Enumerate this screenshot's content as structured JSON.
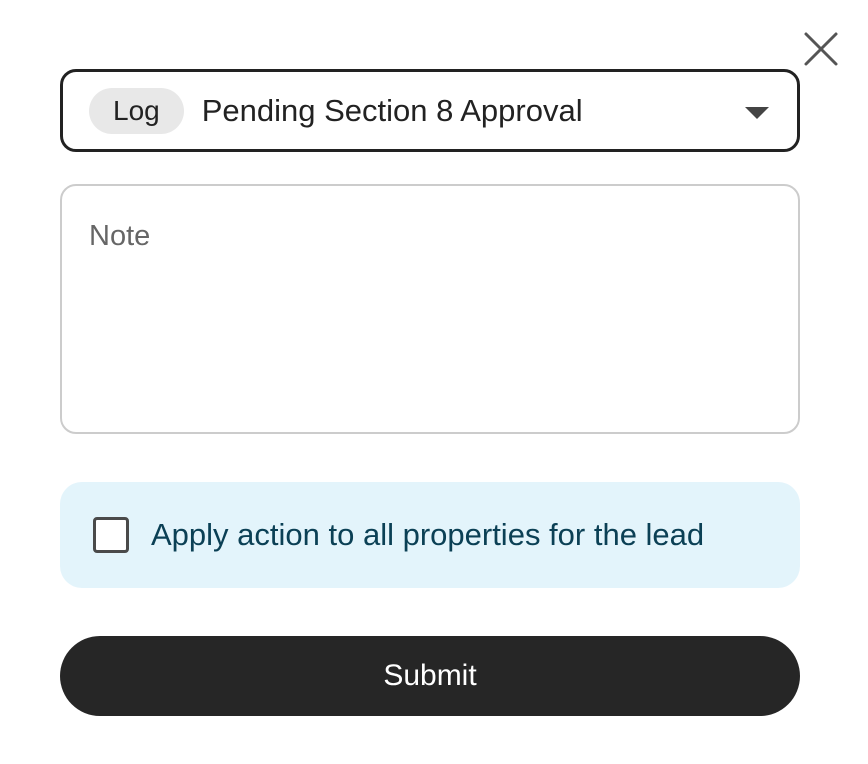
{
  "dialog": {
    "close_icon": "close-icon"
  },
  "action_select": {
    "chip_label": "Log",
    "selected_value": "Pending Section 8 Approval",
    "caret_icon": "caret-down-icon"
  },
  "note_field": {
    "placeholder": "Note",
    "value": ""
  },
  "apply_all": {
    "label": "Apply action to all properties for the lead",
    "checked": false,
    "background_color": "#e3f4fb",
    "text_color": "#0b4055"
  },
  "submit_button": {
    "label": "Submit",
    "background_color": "#262626"
  }
}
